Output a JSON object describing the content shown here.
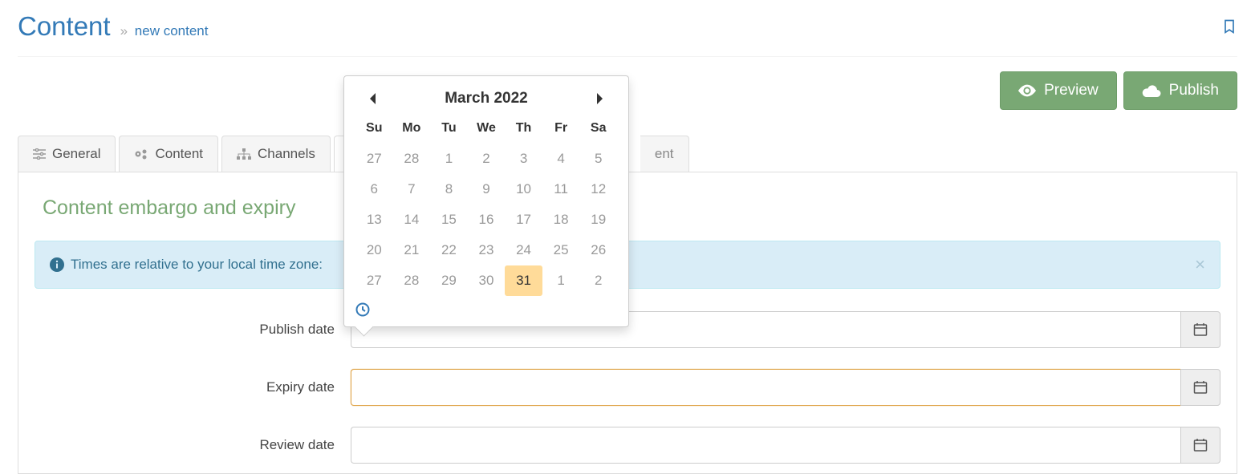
{
  "header": {
    "title": "Content",
    "breadcrumb_sep": "»",
    "breadcrumb": "new content"
  },
  "actions": {
    "preview": "Preview",
    "publish": "Publish"
  },
  "tabs": {
    "general": "General",
    "content": "Content",
    "channels": "Channels",
    "trailing": "ent"
  },
  "section": {
    "title_visible": "Content embargo and expiry"
  },
  "alert": {
    "text_visible": "Times are relative to your local time zone:"
  },
  "form": {
    "publish_label": "Publish date",
    "publish_value": "",
    "expiry_label": "Expiry date",
    "expiry_value": "",
    "review_label": "Review date",
    "review_value": ""
  },
  "datepicker": {
    "title": "March 2022",
    "dow": [
      "Su",
      "Mo",
      "Tu",
      "We",
      "Th",
      "Fr",
      "Sa"
    ],
    "weeks": [
      [
        {
          "d": "27",
          "o": true
        },
        {
          "d": "28",
          "o": true
        },
        {
          "d": "1"
        },
        {
          "d": "2"
        },
        {
          "d": "3"
        },
        {
          "d": "4"
        },
        {
          "d": "5"
        }
      ],
      [
        {
          "d": "6"
        },
        {
          "d": "7"
        },
        {
          "d": "8"
        },
        {
          "d": "9"
        },
        {
          "d": "10"
        },
        {
          "d": "11"
        },
        {
          "d": "12"
        }
      ],
      [
        {
          "d": "13"
        },
        {
          "d": "14"
        },
        {
          "d": "15"
        },
        {
          "d": "16"
        },
        {
          "d": "17"
        },
        {
          "d": "18"
        },
        {
          "d": "19"
        }
      ],
      [
        {
          "d": "20"
        },
        {
          "d": "21"
        },
        {
          "d": "22"
        },
        {
          "d": "23"
        },
        {
          "d": "24"
        },
        {
          "d": "25"
        },
        {
          "d": "26"
        }
      ],
      [
        {
          "d": "27"
        },
        {
          "d": "28"
        },
        {
          "d": "29"
        },
        {
          "d": "30"
        },
        {
          "d": "31",
          "today": true
        },
        {
          "d": "1",
          "o": true
        },
        {
          "d": "2",
          "o": true
        }
      ]
    ]
  },
  "icons": {
    "close_x": "×"
  }
}
